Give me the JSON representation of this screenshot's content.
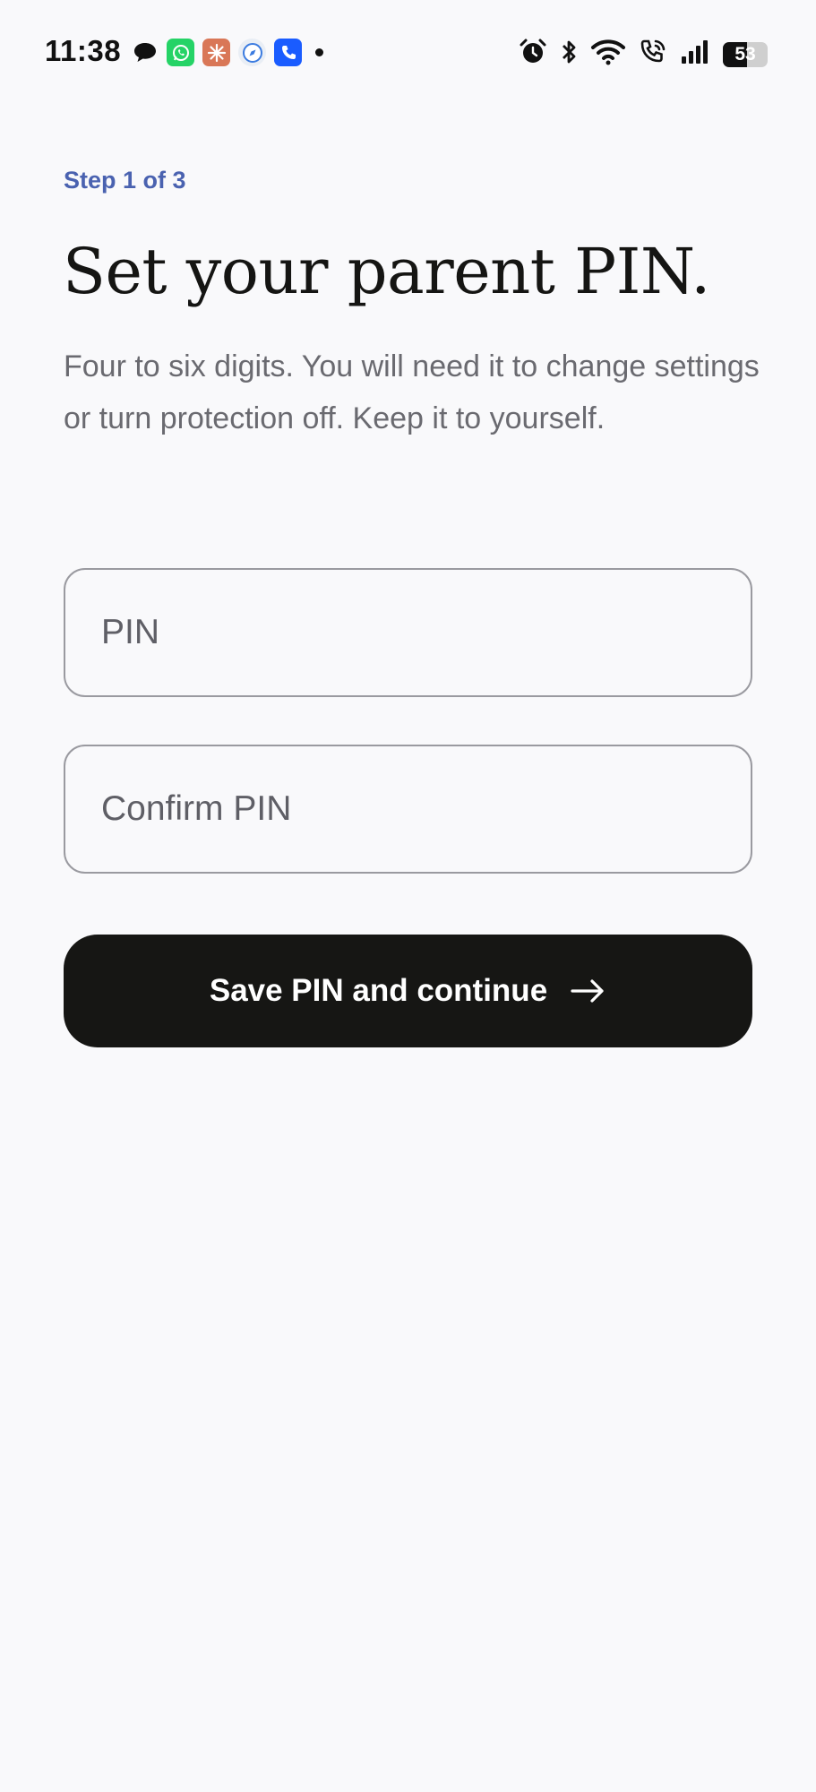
{
  "status_bar": {
    "time": "11:38",
    "battery_level": "53",
    "notification_icons": [
      "chat-bubble-icon",
      "whatsapp-icon",
      "claude-icon",
      "safari-icon",
      "phone-app-icon",
      "dot-icon"
    ],
    "system_icons": [
      "alarm-icon",
      "bluetooth-icon",
      "wifi-icon",
      "wifi-call-icon",
      "signal-icon",
      "battery-icon"
    ]
  },
  "onboarding": {
    "step_label": "Step 1 of 3",
    "title": "Set your parent PIN.",
    "description": "Four to six digits. You will need it to change settings or turn protection off. Keep it to yourself.",
    "pin_field": {
      "placeholder": "PIN",
      "value": ""
    },
    "confirm_field": {
      "placeholder": "Confirm PIN",
      "value": ""
    },
    "submit_button": {
      "label": "Save PIN and continue",
      "icon": "arrow-right-icon"
    }
  },
  "colors": {
    "background": "#f9f9fb",
    "accent": "#4a62b0",
    "button_bg": "#161614",
    "text_primary": "#151513",
    "text_secondary": "#6a6a70",
    "field_border": "#9a9aa0"
  }
}
